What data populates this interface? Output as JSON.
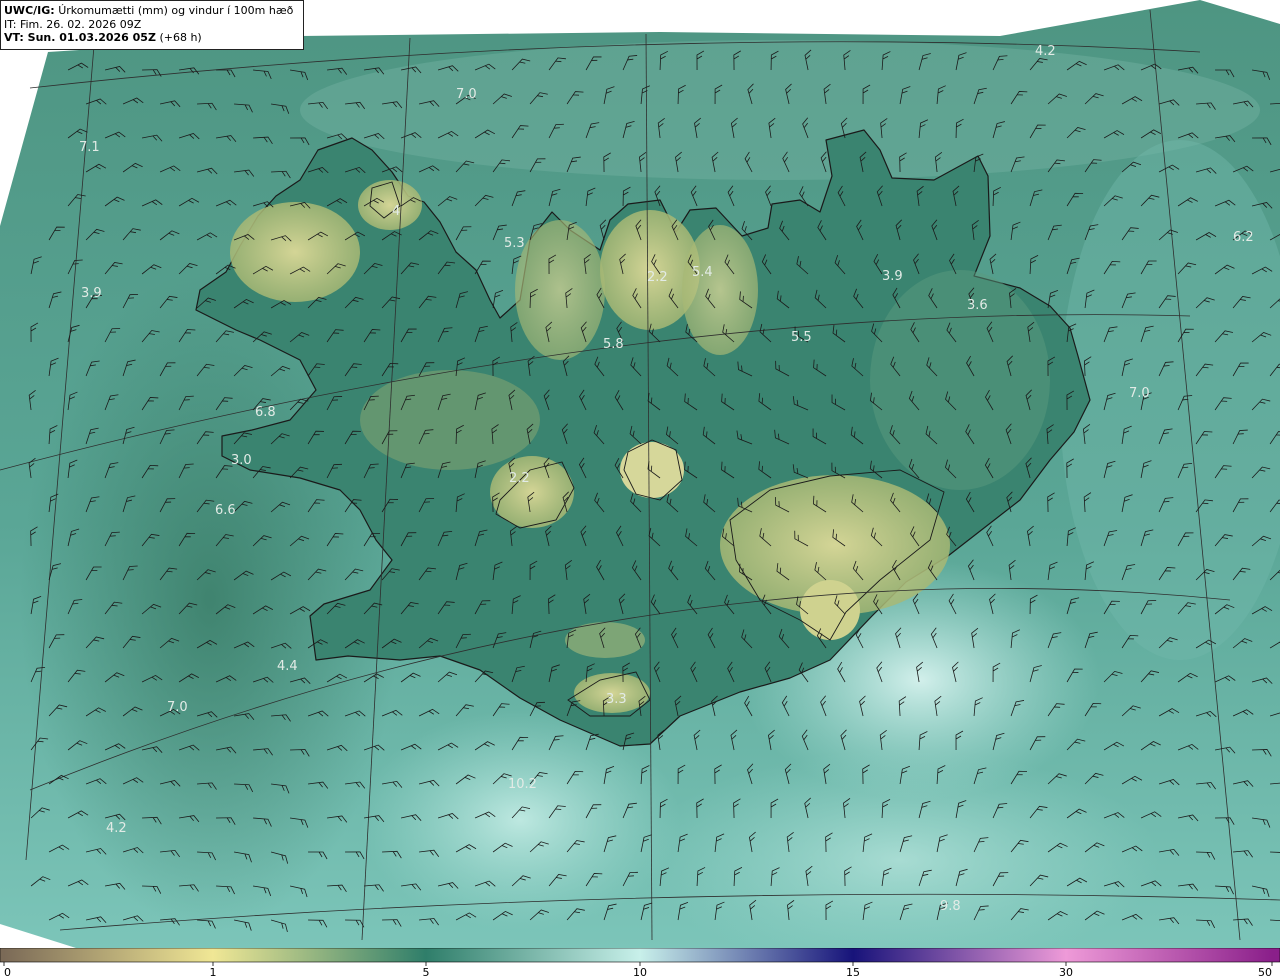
{
  "header": {
    "source_label": "UWC/IG:",
    "title": "Úrkomumætti (mm) og vindur í 100m hæð",
    "init_time": "IT: Fim. 26. 02. 2026 09Z",
    "valid_label": "VT: Sun. 01.03.2026 05Z",
    "lead_time": "(+68 h)"
  },
  "colors": {
    "ocean": "#4f9c8c",
    "land": "#327a66",
    "highland": "#b6c27a",
    "coast": "#1a1a1a",
    "grid": "#2e2e2e",
    "label": "#e2ebe6"
  },
  "value_labels": [
    {
      "text": "4.2"
    },
    {
      "text": "7.0"
    },
    {
      "text": "7.1"
    },
    {
      "text": "5.3"
    },
    {
      "text": "2.2"
    },
    {
      "text": "5.4"
    },
    {
      "text": "3.9"
    },
    {
      "text": "3.6"
    },
    {
      "text": "6.2"
    },
    {
      "text": "3.9"
    },
    {
      "text": "5.8"
    },
    {
      "text": "5.5"
    },
    {
      "text": "7.0"
    },
    {
      "text": "6.8"
    },
    {
      "text": "3.0"
    },
    {
      "text": "2.2"
    },
    {
      "text": "6.6"
    },
    {
      "text": "4.4"
    },
    {
      "text": "7.0"
    },
    {
      "text": "3.3"
    },
    {
      "text": "10.2"
    },
    {
      "text": "4.2"
    },
    {
      "text": "9.8"
    },
    {
      "text": "4"
    }
  ],
  "colorbar": {
    "ticks": [
      {
        "label": "0",
        "value": 0
      },
      {
        "label": "1",
        "value": 1
      },
      {
        "label": "5",
        "value": 5
      },
      {
        "label": "10",
        "value": 10
      },
      {
        "label": "15",
        "value": 15
      },
      {
        "label": "30",
        "value": 30
      },
      {
        "label": "50",
        "value": 50
      }
    ],
    "colors": [
      "#7b6a57",
      "#f0e795",
      "#2f7e6a",
      "#c8f0ea",
      "#17137a",
      "#ee9ad8",
      "#8a1f8a"
    ]
  }
}
